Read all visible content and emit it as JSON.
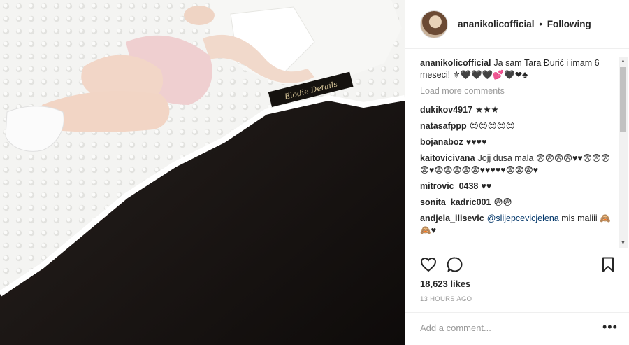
{
  "post": {
    "username": "ananikolicofficial",
    "separator": "•",
    "follow_status": "Following",
    "caption_user": "ananikolicofficial",
    "caption_text": "Ja sam Tara Đurić i imam 6 meseci! ⚜🖤🖤🖤💕🖤❤♣",
    "load_more": "Load more comments",
    "likes": "18,623 likes",
    "time": "13 HOURS AGO",
    "add_comment_placeholder": "Add a comment...",
    "more_label": "•••",
    "photo_label": "Elodie Details"
  },
  "comments": [
    {
      "user": "dukikov4917",
      "text": "★★★"
    },
    {
      "user": "natasafppp",
      "text": "😍😍😍😍😍"
    },
    {
      "user": "bojanaboz",
      "text": "♥♥♥♥"
    },
    {
      "user": "kaitovicivana",
      "text": "Jojj dusa mala 😨😨😨😨♥♥😨😨😨😨♥😨😨😨😨😨♥♥♥♥♥😨😨😨♥"
    },
    {
      "user": "mitrovic_0438",
      "text": "♥♥"
    },
    {
      "user": "sonita_kadric001",
      "text": "😨😨"
    },
    {
      "user": "andjela_ilisevic",
      "mention": "@slijepcevicjelena",
      "text": "mis maliii 🙈🙈♥"
    }
  ],
  "icons": [
    "heart-icon",
    "comment-icon",
    "bookmark-icon",
    "more-icon"
  ]
}
